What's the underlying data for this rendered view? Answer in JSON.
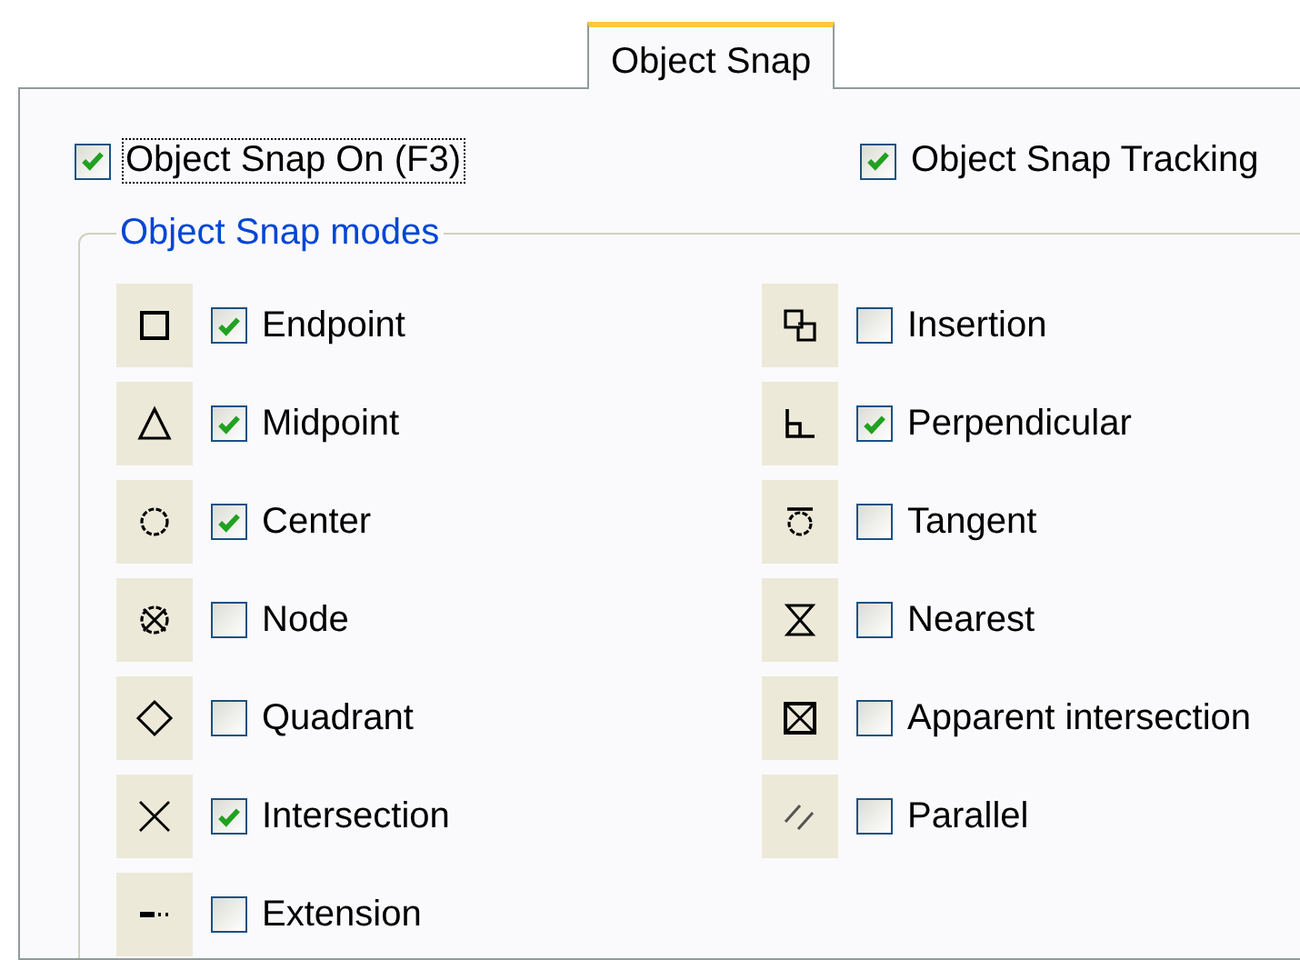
{
  "tabs": [
    {
      "label": "Object Snap",
      "selected": true
    }
  ],
  "options": [
    {
      "label": "Object Snap On (F3)",
      "checked": true,
      "focused": true
    },
    {
      "label": "Object Snap Tracking",
      "checked": true,
      "focused": false
    }
  ],
  "group": {
    "title": "Object Snap modes",
    "columns": [
      [
        {
          "label": "Endpoint",
          "checked": true
        },
        {
          "label": "Midpoint",
          "checked": true
        },
        {
          "label": "Center",
          "checked": true
        },
        {
          "label": "Node",
          "checked": false
        },
        {
          "label": "Quadrant",
          "checked": false
        },
        {
          "label": "Intersection",
          "checked": true
        },
        {
          "label": "Extension",
          "checked": false
        }
      ],
      [
        {
          "label": "Insertion",
          "checked": false
        },
        {
          "label": "Perpendicular",
          "checked": true
        },
        {
          "label": "Tangent",
          "checked": false
        },
        {
          "label": "Nearest",
          "checked": false
        },
        {
          "label": "Apparent intersection",
          "checked": false
        },
        {
          "label": "Parallel",
          "checked": false
        }
      ]
    ]
  }
}
